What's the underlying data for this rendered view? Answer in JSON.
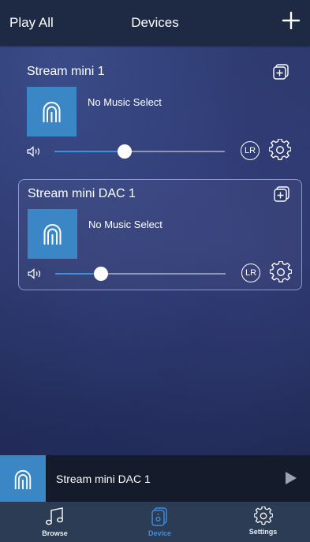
{
  "header": {
    "play_all_label": "Play All",
    "title": "Devices",
    "add_icon": "plus-icon"
  },
  "devices": [
    {
      "name": "Stream mini 1",
      "status": "No Music Select",
      "volume_fraction": 0.41,
      "channel_label": "LR",
      "selected": false
    },
    {
      "name": "Stream mini DAC 1",
      "status": "No Music Select",
      "volume_fraction": 0.27,
      "channel_label": "LR",
      "selected": true
    }
  ],
  "now_playing": {
    "device_name": "Stream mini DAC 1"
  },
  "tabs": [
    {
      "label": "Browse",
      "icon": "music-note-icon",
      "active": false
    },
    {
      "label": "Device",
      "icon": "speaker-icon",
      "active": true
    },
    {
      "label": "Settings",
      "icon": "gear-icon",
      "active": false
    }
  ],
  "colors": {
    "accent": "#3f8edb",
    "artwork_blue": "#3b86c4",
    "topbar": "#1e2a44",
    "tabbar": "#2c3c55"
  }
}
